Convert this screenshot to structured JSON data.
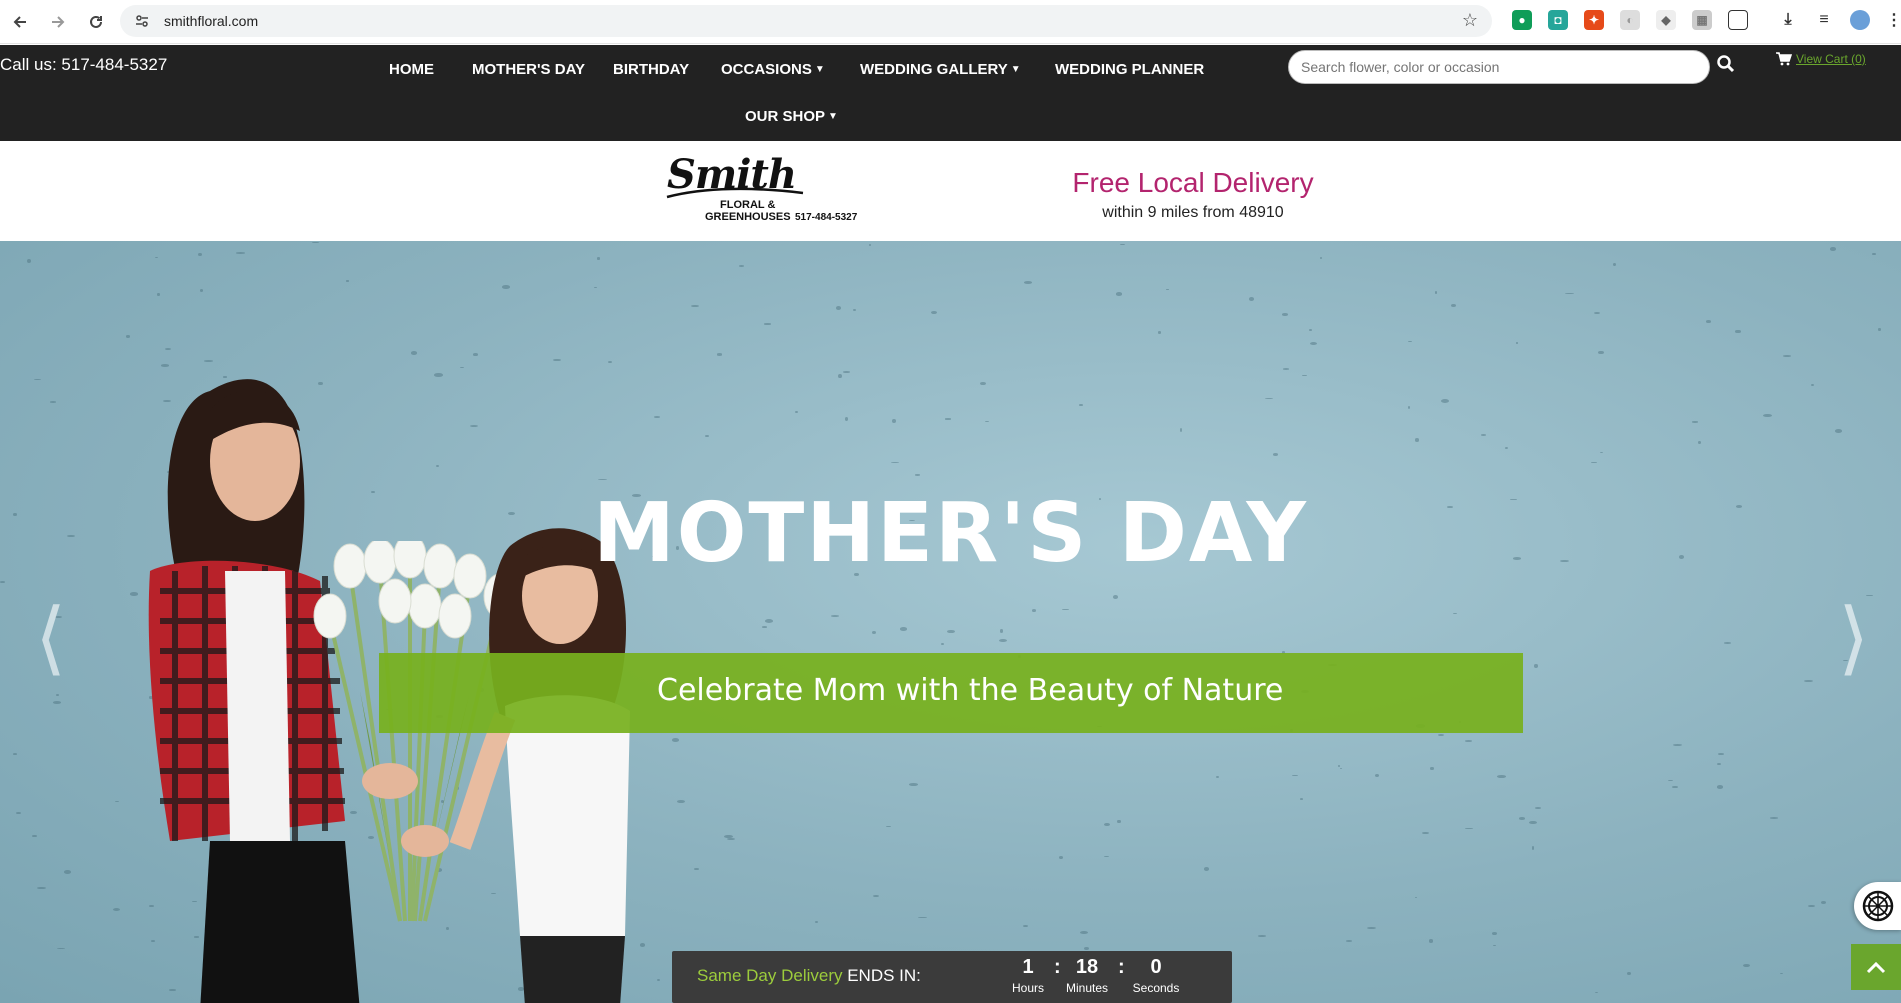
{
  "browser": {
    "url": "smithfloral.com",
    "back_icon": "arrow-left-icon",
    "forward_icon": "arrow-right-icon",
    "reload_icon": "reload-icon",
    "bookmark_icon": "star-icon"
  },
  "topnav": {
    "call_us": "Call us: 517-484-5327",
    "menu": [
      {
        "label": "HOME"
      },
      {
        "label": "MOTHER'S DAY"
      },
      {
        "label": "BIRTHDAY"
      },
      {
        "label": "OCCASIONS"
      },
      {
        "label": "WEDDING GALLERY"
      },
      {
        "label": "WEDDING PLANNER"
      },
      {
        "label": "OUR SHOP"
      }
    ],
    "search_placeholder": "Search flower, color or occasion",
    "cart_label": "View Cart (0)"
  },
  "header": {
    "logo_script": "Smith",
    "logo_line1": "FLORAL &",
    "logo_line2": "GREENHOUSES",
    "logo_phone": "517-484-5327",
    "delivery_title": "Free Local Delivery",
    "delivery_sub": "within 9 miles from 48910"
  },
  "hero": {
    "title": "MOTHER'S DAY",
    "tagline": "Celebrate Mom with the Beauty of Nature",
    "prev_arrow": "⟨",
    "next_arrow": "⟩"
  },
  "countdown": {
    "label_highlight": "Same Day Delivery",
    "label_rest": " ENDS IN:",
    "hours": "1",
    "minutes": "18",
    "seconds": "0",
    "hours_label": "Hours",
    "minutes_label": "Minutes",
    "seconds_label": "Seconds",
    "separator": ":"
  },
  "colors": {
    "nav_bg": "#222222",
    "accent_green": "#77b01e",
    "delivery_pink": "#b3246e"
  }
}
